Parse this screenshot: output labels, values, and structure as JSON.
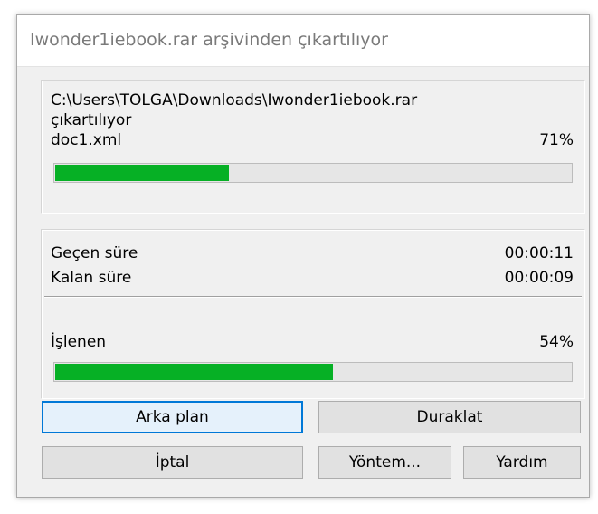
{
  "window": {
    "title": "Iwonder1iebook.rar arşivinden çıkartılıyor"
  },
  "file_panel": {
    "archive_path": "C:\\Users\\TOLGA\\Downloads\\Iwonder1iebook.rar",
    "action": "çıkartılıyor",
    "current_file": "doc1.xml",
    "file_percent_text": "71%",
    "file_progress": 0.34
  },
  "time_panel": {
    "elapsed_label": "Geçen süre",
    "elapsed_value": "00:00:11",
    "remaining_label": "Kalan süre",
    "remaining_value": "00:00:09",
    "processed_label": "İşlenen",
    "processed_percent_text": "54%",
    "processed_progress": 0.54
  },
  "buttons": {
    "background": "Arka plan",
    "pause": "Duraklat",
    "cancel": "İptal",
    "mode": "Yöntem...",
    "help": "Yardım"
  },
  "colors": {
    "progress_fill": "#06b025",
    "focus_border": "#0078d7"
  }
}
